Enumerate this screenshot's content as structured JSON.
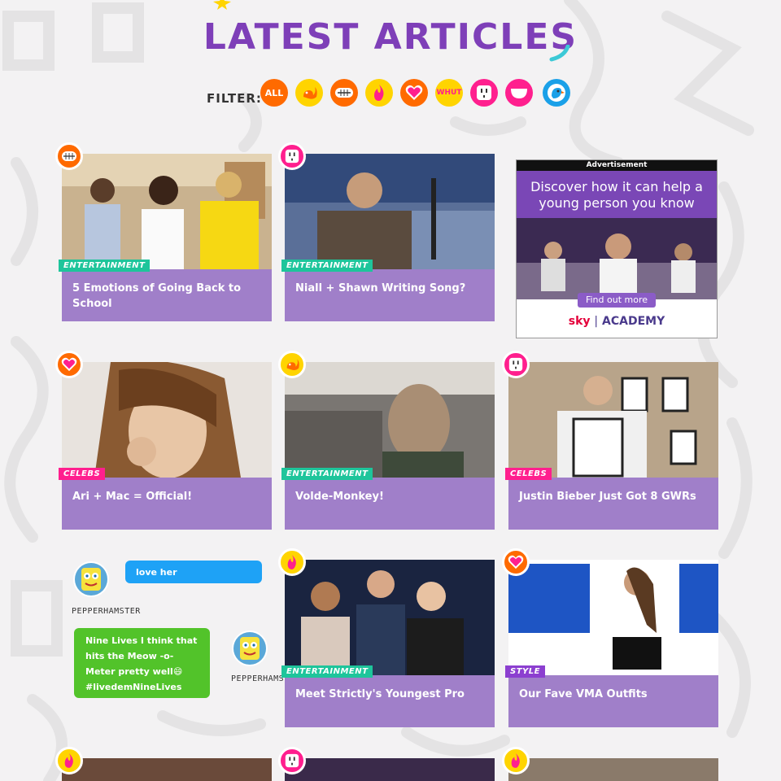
{
  "page": {
    "title": "LATEST ARTICLES",
    "filter_label": "FILTER:",
    "filter_all_label": "ALL"
  },
  "filters": [
    {
      "label": "ALL",
      "icon": "all-icon",
      "color": "#ff6a00"
    },
    {
      "icon": "squirrel-icon",
      "color": "#ffd400"
    },
    {
      "icon": "grin-icon",
      "color": "#ff6a00"
    },
    {
      "icon": "fire-icon",
      "color": "#ffd400"
    },
    {
      "icon": "heart-icon",
      "color": "#ff6a00"
    },
    {
      "icon": "whut-icon",
      "label": "WHUT",
      "color": "#ffd400"
    },
    {
      "icon": "socket-icon",
      "color": "#ff1f8e"
    },
    {
      "icon": "laugh-icon",
      "color": "#ff1f8e"
    },
    {
      "icon": "bird-icon",
      "color": "#ffd400"
    }
  ],
  "articles": [
    {
      "headline": "5 Emotions of Going Back to School",
      "tag": "ENTERTAINMENT",
      "badge": "grin-icon"
    },
    {
      "headline": "Niall + Shawn Writing Song?",
      "tag": "ENTERTAINMENT",
      "badge": "socket-icon"
    },
    {
      "headline": "Ari + Mac = Official!",
      "tag": "CELEBS",
      "badge": "heart-icon"
    },
    {
      "headline": "Volde-Monkey!",
      "tag": "ENTERTAINMENT",
      "badge": "squirrel-icon"
    },
    {
      "headline": "Justin Bieber Just Got 8 GWRs",
      "tag": "CELEBS",
      "badge": "socket-icon"
    },
    {
      "headline": "Meet Strictly's Youngest Pro",
      "tag": "ENTERTAINMENT",
      "badge": "fire-icon"
    },
    {
      "headline": "Our Fave VMA Outfits",
      "tag": "STYLE",
      "badge": "heart-icon"
    }
  ],
  "ad": {
    "label": "Advertisement",
    "headline": "Discover how it can help a young person you know",
    "button": "Find out more",
    "brand_sky": "sky",
    "brand_name": "ACADEMY"
  },
  "chat": {
    "user1": "PEPPERHAMSTER",
    "message1": "love her",
    "message2": "Nine Lives I think that hits the Meow -o- Meter pretty well😄 #livedemNineLives",
    "user2": "PEPPERHAMSTE"
  },
  "colors": {
    "accent_purple": "#7e3fb8",
    "card_band": "#a07fc9",
    "tag_entertainment": "#1ec59b",
    "tag_celebs": "#ff1f8e",
    "tag_style": "#8c3fd0",
    "chat_blue": "#1ea2f6",
    "chat_green": "#52c32a"
  }
}
